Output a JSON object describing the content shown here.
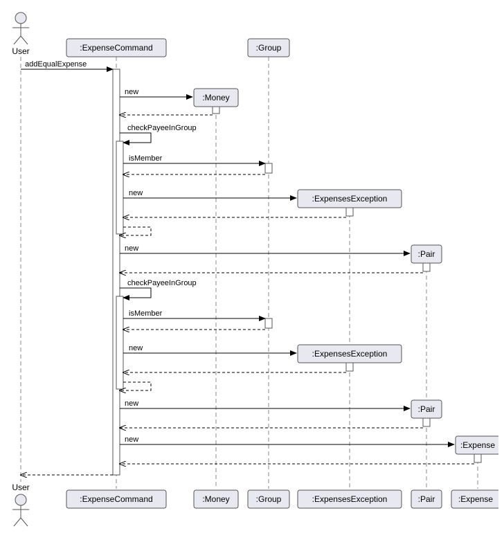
{
  "actor": {
    "name": "User"
  },
  "participants": {
    "expenseCommand": ":ExpenseCommand",
    "money": ":Money",
    "group": ":Group",
    "expensesException": ":ExpensesException",
    "pair": ":Pair",
    "expense": ":Expense"
  },
  "messages": {
    "addEqualExpense": "addEqualExpense",
    "new": "new",
    "checkPayeeInGroup": "checkPayeeInGroup",
    "isMember": "isMember"
  },
  "chart_data": {
    "type": "sequence-diagram",
    "actors": [
      "User"
    ],
    "participants": [
      ":ExpenseCommand",
      ":Money",
      ":Group",
      ":ExpensesException",
      ":Pair",
      ":Expense"
    ],
    "messages": [
      {
        "from": "User",
        "to": ":ExpenseCommand",
        "label": "addEqualExpense",
        "style": "solid"
      },
      {
        "from": ":ExpenseCommand",
        "to": ":Money",
        "label": "new",
        "style": "solid",
        "create": true
      },
      {
        "from": ":Money",
        "to": ":ExpenseCommand",
        "label": "",
        "style": "dashed"
      },
      {
        "from": ":ExpenseCommand",
        "to": ":ExpenseCommand",
        "label": "checkPayeeInGroup",
        "style": "solid",
        "self": true
      },
      {
        "from": ":ExpenseCommand",
        "to": ":Group",
        "label": "isMember",
        "style": "solid"
      },
      {
        "from": ":Group",
        "to": ":ExpenseCommand",
        "label": "",
        "style": "dashed"
      },
      {
        "from": ":ExpenseCommand",
        "to": ":ExpensesException",
        "label": "new",
        "style": "solid",
        "create": true
      },
      {
        "from": ":ExpensesException",
        "to": ":ExpenseCommand",
        "label": "",
        "style": "dashed"
      },
      {
        "from": ":ExpenseCommand",
        "to": ":ExpenseCommand",
        "label": "",
        "style": "dashed",
        "self": true
      },
      {
        "from": ":ExpenseCommand",
        "to": ":Pair",
        "label": "new",
        "style": "solid",
        "create": true
      },
      {
        "from": ":Pair",
        "to": ":ExpenseCommand",
        "label": "",
        "style": "dashed"
      },
      {
        "from": ":ExpenseCommand",
        "to": ":ExpenseCommand",
        "label": "checkPayeeInGroup",
        "style": "solid",
        "self": true
      },
      {
        "from": ":ExpenseCommand",
        "to": ":Group",
        "label": "isMember",
        "style": "solid"
      },
      {
        "from": ":Group",
        "to": ":ExpenseCommand",
        "label": "",
        "style": "dashed"
      },
      {
        "from": ":ExpenseCommand",
        "to": ":ExpensesException",
        "label": "new",
        "style": "solid",
        "create": true
      },
      {
        "from": ":ExpensesException",
        "to": ":ExpenseCommand",
        "label": "",
        "style": "dashed"
      },
      {
        "from": ":ExpenseCommand",
        "to": ":ExpenseCommand",
        "label": "",
        "style": "dashed",
        "self": true
      },
      {
        "from": ":ExpenseCommand",
        "to": ":Pair",
        "label": "new",
        "style": "solid",
        "create": true
      },
      {
        "from": ":Pair",
        "to": ":ExpenseCommand",
        "label": "",
        "style": "dashed"
      },
      {
        "from": ":ExpenseCommand",
        "to": ":Expense",
        "label": "new",
        "style": "solid",
        "create": true
      },
      {
        "from": ":Expense",
        "to": ":ExpenseCommand",
        "label": "",
        "style": "dashed"
      },
      {
        "from": ":ExpenseCommand",
        "to": "User",
        "label": "",
        "style": "dashed"
      }
    ]
  }
}
